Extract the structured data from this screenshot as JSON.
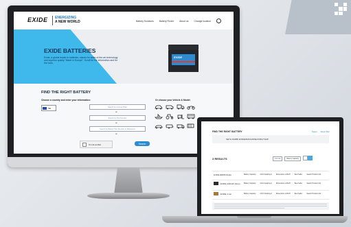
{
  "monitor_site": {
    "logo": "EXIDE",
    "tagline_line1": "ENERGIZING",
    "tagline_line2": "A NEW WORLD",
    "nav": [
      "Battery Solutions",
      "Battery Finder",
      "About us",
      "Change location"
    ],
    "hero_title": "EXIDE BATTERIES",
    "hero_text": "Exide, a global leader in batteries, stands for state-of-the-art technology and superior quality \"Made in Europe\". Scroll for the information and for the tools.",
    "find_title": "FIND THE RIGHT BATTERY",
    "left_label": "Choose a country and enter your information:",
    "right_label": "Or choose your Vehicle & Model:",
    "country_code": "SE",
    "inputs": [
      "Search by License Plate",
      "Search by Part Number",
      "Search by Battery Part Number or Reference"
    ],
    "or_text": "or",
    "captcha_label": "I'm not a robot",
    "search_button": "Search"
  },
  "laptop_site": {
    "title": "FIND THE RIGHT BATTERY",
    "links": [
      "Select",
      "Reset filter"
    ],
    "query": "SETH DARBI EXIDE/6MA EXIDE/4VRG/?4HP",
    "results": "3 RESULTS",
    "sort": [
      "4 in row",
      "Battery Capacity"
    ],
    "rows": [
      {
        "name": "EXIDE EB456 Repla",
        "cells": [
          "Battery Capacity",
          "Cold Cranking A",
          "Dimensions LxWxH",
          "Best Seller",
          "Search Product info"
        ]
      },
      {
        "name": "EXIDE AGM EK (Drop)",
        "cells": [
          "Battery Capacity",
          "Cold Cranking A",
          "Dimensions LxWxH",
          "Best Seller",
          "Search Product info"
        ]
      },
      {
        "name": "EXIDE 4 Car",
        "cells": [
          "Battery Capacity",
          "Cold Cranking A",
          "Dimensions LxWxH",
          "Best Seller",
          "Search Product info"
        ]
      }
    ]
  },
  "colors": {
    "brand_blue": "#2d8bd0",
    "hero_cyan": "#3fb8ec",
    "navy": "#10355b"
  },
  "icons": [
    "qr-code-icon",
    "search-icon",
    "car-icon",
    "van-icon",
    "truck-icon",
    "motorcycle-icon",
    "tractor-icon",
    "boat-icon",
    "bus-icon",
    "forklift-icon",
    "caravan-icon"
  ]
}
